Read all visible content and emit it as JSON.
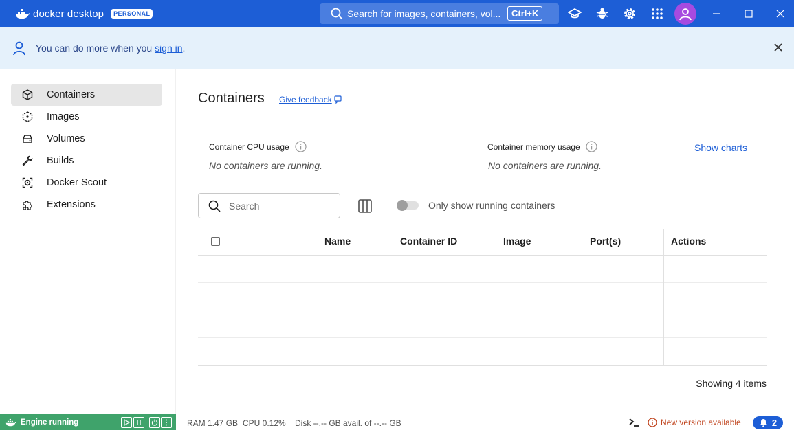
{
  "titlebar": {
    "brand": "docker desktop",
    "plan_badge": "PERSONAL",
    "search_text": "Search for images, containers, vol...",
    "search_shortcut": "Ctrl+K"
  },
  "banner": {
    "message_prefix": "You can do more when you ",
    "link_text": "sign in",
    "message_suffix": "."
  },
  "sidebar": {
    "items": [
      {
        "label": "Containers",
        "icon": "container-icon",
        "active": true
      },
      {
        "label": "Images",
        "icon": "images-icon",
        "active": false
      },
      {
        "label": "Volumes",
        "icon": "volumes-icon",
        "active": false
      },
      {
        "label": "Builds",
        "icon": "wrench-icon",
        "active": false
      },
      {
        "label": "Docker Scout",
        "icon": "scout-icon",
        "active": false
      },
      {
        "label": "Extensions",
        "icon": "puzzle-icon",
        "active": false
      }
    ]
  },
  "main": {
    "title": "Containers",
    "feedback_link": "Give feedback",
    "cpu_label": "Container CPU usage",
    "cpu_value": "No containers are running.",
    "memory_label": "Container memory usage",
    "memory_value": "No containers are running.",
    "show_charts": "Show charts",
    "search_placeholder": "Search",
    "toggle_label": "Only show running containers",
    "table": {
      "columns": [
        "Name",
        "Container ID",
        "Image",
        "Port(s)",
        "Actions"
      ],
      "row_count": 4
    },
    "showing_text": "Showing 4 items"
  },
  "statusbar": {
    "engine_status": "Engine running",
    "ram": "RAM 1.47 GB",
    "cpu": "CPU 0.12%",
    "disk": "Disk --.-- GB avail. of --.-- GB",
    "new_version": "New version available",
    "notification_count": "2"
  },
  "colors": {
    "brand_blue": "#1d5ed6",
    "engine_green": "#3fa36b",
    "banner_bg": "#e5f1fb",
    "warning": "#c0451f"
  }
}
